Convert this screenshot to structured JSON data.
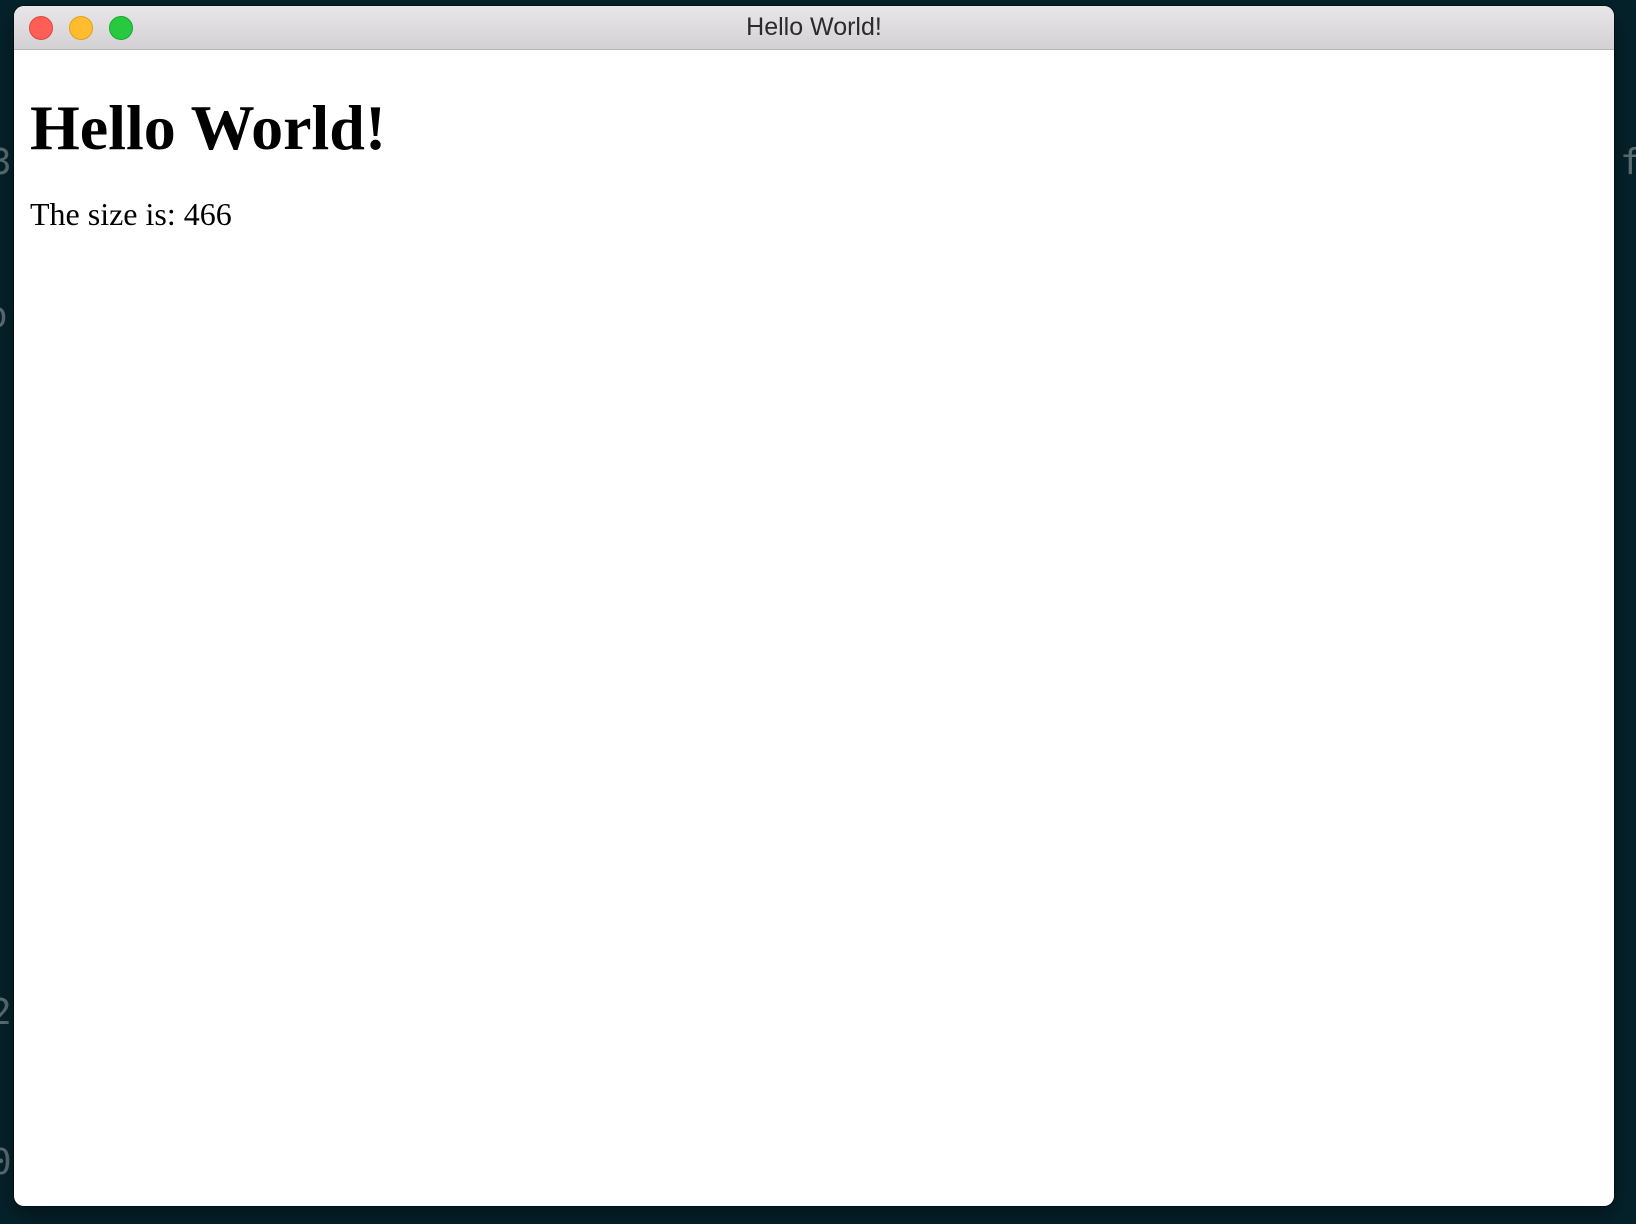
{
  "desktop": {
    "background_color": "#05222b",
    "background_glyphs": [
      "3",
      "o",
      "2",
      "0",
      "f"
    ]
  },
  "window": {
    "title": "Hello World!",
    "controls": {
      "close_color": "#fd5f57",
      "minimize_color": "#febc2e",
      "zoom_color": "#28c840"
    }
  },
  "page": {
    "heading": "Hello World!",
    "size_text": "The size is: 466"
  }
}
